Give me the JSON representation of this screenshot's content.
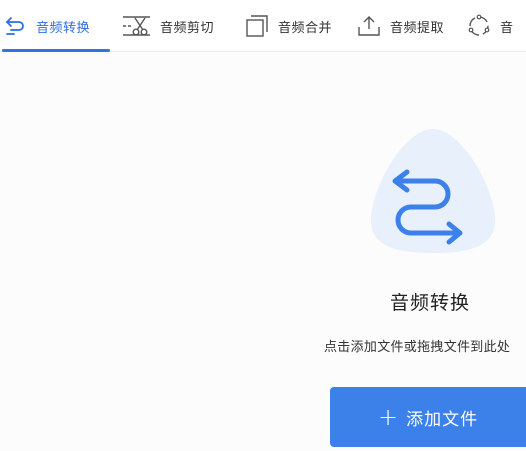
{
  "tabs": [
    {
      "label": "音频转换",
      "icon": "convert-arrows-icon",
      "active": true
    },
    {
      "label": "音频剪切",
      "icon": "scissors-icon",
      "active": false
    },
    {
      "label": "音频合并",
      "icon": "merge-squares-icon",
      "active": false
    },
    {
      "label": "音频提取",
      "icon": "upload-tray-icon",
      "active": false
    },
    {
      "label": "音",
      "icon": "circle-loop-icon",
      "active": false
    }
  ],
  "hero": {
    "icon": "convert-arrows-icon",
    "title": "音频转换",
    "hint": "点击添加文件或拖拽文件到此处"
  },
  "add_button": {
    "icon": "plus-icon",
    "label": "添加文件"
  },
  "colors": {
    "accent": "#2f74e6",
    "button": "#3c80ea",
    "blob": "#e8f0fc"
  }
}
